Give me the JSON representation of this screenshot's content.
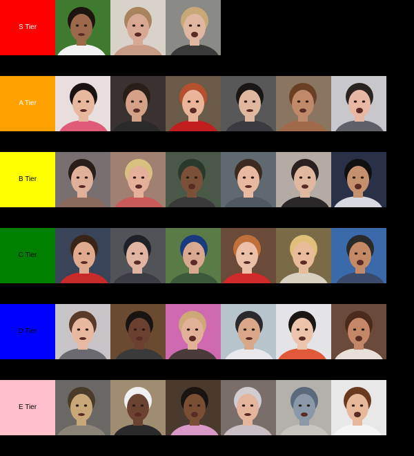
{
  "tiers": [
    {
      "label": "S Tier",
      "color": "#ff0000",
      "text_color": "#ffffff",
      "items": [
        {
          "bg": "#3f7a2e",
          "skin": "#9a6a4a",
          "hair": "#1d1410",
          "shirt": "#f2f2f2"
        },
        {
          "bg": "#d8d2c8",
          "skin": "#d8a894",
          "hair": "#a8845e",
          "shirt": "#c79a86"
        },
        {
          "bg": "#8a8a86",
          "skin": "#e0b8a2",
          "hair": "#c9a878",
          "shirt": "#3a3a3a"
        }
      ]
    },
    {
      "label": "A Tier",
      "color": "#ffa000",
      "text_color": "#ffffff",
      "items": [
        {
          "bg": "#e8dede",
          "skin": "#e8b89e",
          "hair": "#1a1210",
          "shirt": "#e05a7a"
        },
        {
          "bg": "#3a3230",
          "skin": "#d4a088",
          "hair": "#2a1e18",
          "shirt": "#2a2a2a"
        },
        {
          "bg": "#6a5a48",
          "skin": "#e8b49a",
          "hair": "#b5502e",
          "shirt": "#c21e1e"
        },
        {
          "bg": "#585858",
          "skin": "#e0b8a0",
          "hair": "#1a1614",
          "shirt": "#3a3a40"
        },
        {
          "bg": "#8a7560",
          "skin": "#c08a6a",
          "hair": "#6a4024",
          "shirt": "#a06a4a"
        },
        {
          "bg": "#c8c8cc",
          "skin": "#e8b8a4",
          "hair": "#2a2420",
          "shirt": "#606068"
        }
      ]
    },
    {
      "label": "B Tier",
      "color": "#ffff00",
      "text_color": "#000000",
      "items": [
        {
          "bg": "#787070",
          "skin": "#e0b09a",
          "hair": "#2a1e1a",
          "shirt": "#8a6a5a"
        },
        {
          "bg": "#a08070",
          "skin": "#e4b09a",
          "hair": "#d8c080",
          "shirt": "#c85a5a"
        },
        {
          "bg": "#4a5848",
          "skin": "#7a5038",
          "hair": "#2a3a2a",
          "shirt": "#3a3a3a"
        },
        {
          "bg": "#606870",
          "skin": "#e8b8a0",
          "hair": "#3a2a20",
          "shirt": "#505860"
        },
        {
          "bg": "#b4aca4",
          "skin": "#e0b8a0",
          "hair": "#2a2020",
          "shirt": "#2a2828"
        },
        {
          "bg": "#2a3048",
          "skin": "#c4906e",
          "hair": "#101010",
          "shirt": "#d8d8e0"
        }
      ]
    },
    {
      "label": "C Tier",
      "color": "#008000",
      "text_color": "#000000",
      "items": [
        {
          "bg": "#3a4458",
          "skin": "#e0aa8e",
          "hair": "#3a2418",
          "shirt": "#c82a2a"
        },
        {
          "bg": "#505458",
          "skin": "#e0b4a0",
          "hair": "#1e2228",
          "shirt": "#3a3e44"
        },
        {
          "bg": "#5a7a48",
          "skin": "#d8a890",
          "hair": "#1a3a80",
          "shirt": "#3a5a3a"
        },
        {
          "bg": "#6a4a38",
          "skin": "#ecc0a8",
          "hair": "#c0703a",
          "shirt": "#d02a2a"
        },
        {
          "bg": "#7a6a48",
          "skin": "#e8bc9a",
          "hair": "#e0c078",
          "shirt": "#d8d0c0"
        },
        {
          "bg": "#3a6aaa",
          "skin": "#c48a66",
          "hair": "#2a2a2a",
          "shirt": "#3a4a6a"
        }
      ]
    },
    {
      "label": "D Tier",
      "color": "#0000ff",
      "text_color": "#000000",
      "items": [
        {
          "bg": "#c8c4c8",
          "skin": "#e8b8a0",
          "hair": "#5a3a28",
          "shirt": "#6a6a70"
        },
        {
          "bg": "#6a4a30",
          "skin": "#6a4030",
          "hair": "#1a1410",
          "shirt": "#3a3a3a"
        },
        {
          "bg": "#d06ab0",
          "skin": "#e0b098",
          "hair": "#d0a878",
          "shirt": "#4a3a3a"
        },
        {
          "bg": "#b8c4cc",
          "skin": "#d8a888",
          "hair": "#2a2a2e",
          "shirt": "#e8e8ec"
        },
        {
          "bg": "#e4e4e8",
          "skin": "#ecc4ac",
          "hair": "#1a1614",
          "shirt": "#e05a3a"
        },
        {
          "bg": "#6a4a3a",
          "skin": "#c48868",
          "hair": "#4a2a1a",
          "shirt": "#e8e0d8"
        }
      ]
    },
    {
      "label": "E Tier",
      "color": "#ffc0cb",
      "text_color": "#000000",
      "items": [
        {
          "bg": "#6a6864",
          "skin": "#c8a878",
          "hair": "#4a3a28",
          "shirt": "#8a8478"
        },
        {
          "bg": "#a08c70",
          "skin": "#6a4430",
          "hair": "#f0f0f0",
          "shirt": "#2a2a2a"
        },
        {
          "bg": "#4a3a2e",
          "skin": "#7a4e34",
          "hair": "#1a1410",
          "shirt": "#d898c8"
        },
        {
          "bg": "#7a6e6a",
          "skin": "#e4b49c",
          "hair": "#d0ccd0",
          "shirt": "#c8c0c4"
        },
        {
          "bg": "#b4b0ac",
          "skin": "#8a98a8",
          "hair": "#5a6a7a",
          "shirt": "#c8c4c0"
        },
        {
          "bg": "#e8e8e8",
          "skin": "#e8b89a",
          "hair": "#6a3a20",
          "shirt": "#f4f4f4"
        }
      ]
    }
  ]
}
